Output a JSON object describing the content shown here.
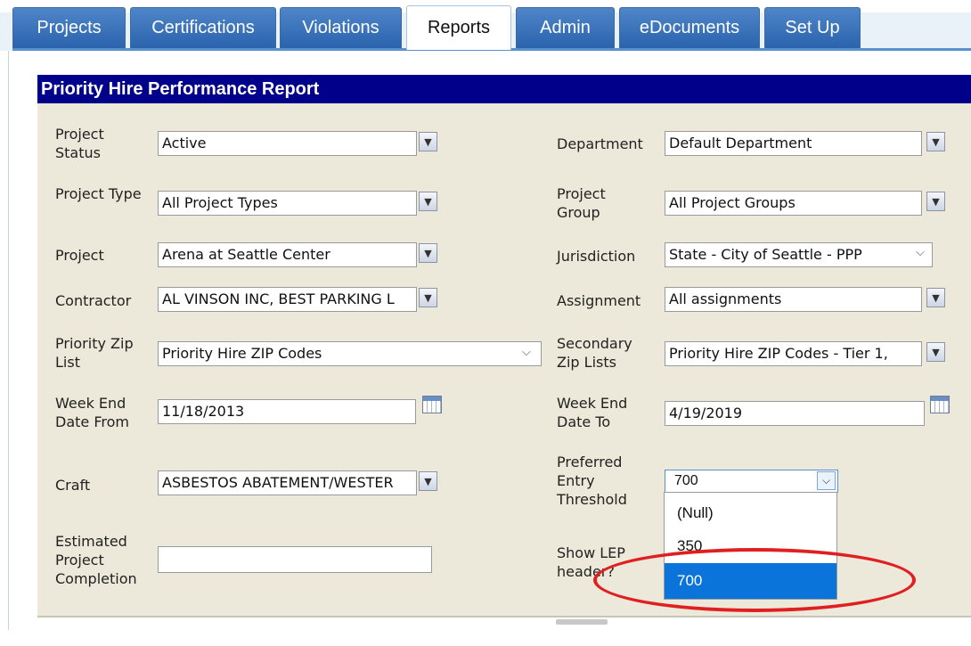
{
  "tabs": [
    "Projects",
    "Certifications",
    "Violations",
    "Reports",
    "Admin",
    "eDocuments",
    "Set Up"
  ],
  "active_tab": "Reports",
  "panel_title": "Priority Hire Performance Report",
  "left": {
    "project_status": {
      "label": "Project Status",
      "value": "Active"
    },
    "project_type": {
      "label": "Project Type",
      "value": "All Project Types"
    },
    "project": {
      "label": "Project",
      "value": "Arena at Seattle Center"
    },
    "contractor": {
      "label": "Contractor",
      "value": "AL VINSON INC, BEST PARKING L"
    },
    "priority_zip": {
      "label": "Priority Zip List",
      "value": "Priority Hire ZIP Codes"
    },
    "week_from": {
      "label": "Week End Date From",
      "value": "11/18/2013"
    },
    "craft": {
      "label": "Craft",
      "value": "ASBESTOS ABATEMENT/WESTER"
    },
    "completion": {
      "label": "Estimated Project Completion",
      "value": ""
    }
  },
  "right": {
    "department": {
      "label": "Department",
      "value": "Default Department"
    },
    "project_group": {
      "label": "Project Group",
      "value": "All Project Groups"
    },
    "jurisdiction": {
      "label": "Jurisdiction",
      "value": "State - City of Seattle - PPP"
    },
    "assignment": {
      "label": "Assignment",
      "value": "All assignments"
    },
    "secondary_zip": {
      "label": "Secondary Zip Lists",
      "value": "Priority Hire ZIP Codes - Tier 1,"
    },
    "week_to": {
      "label": "Week End Date To",
      "value": "4/19/2019"
    },
    "threshold": {
      "label": "Preferred Entry Threshold",
      "value": "700",
      "options": [
        "(Null)",
        "350",
        "700"
      ],
      "selected": "700"
    },
    "show_lep": {
      "label": "Show LEP header?"
    }
  },
  "colors": {
    "tab_blue": "#2b63ad",
    "title_bar": "#00008b",
    "panel_bg": "#ece8da",
    "highlight": "#0a74da",
    "annotation": "#e02020"
  }
}
